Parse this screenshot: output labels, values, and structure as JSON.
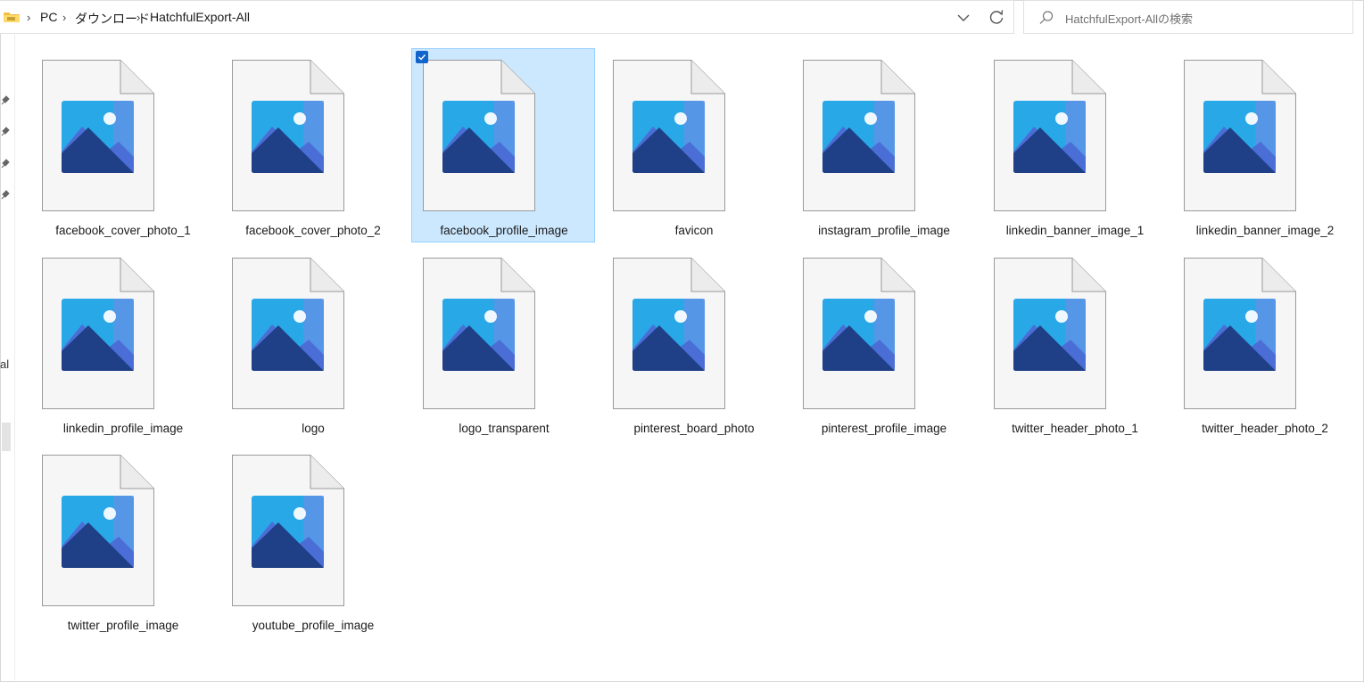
{
  "breadcrumb": {
    "items": [
      "PC",
      "ダウンロード",
      "HatchfulExport-All"
    ]
  },
  "search": {
    "placeholder": "HatchfulExport-Allの検索"
  },
  "nav_fragment": "al",
  "files": [
    {
      "name": "facebook_cover_photo_1",
      "selected": false
    },
    {
      "name": "facebook_cover_photo_2",
      "selected": false
    },
    {
      "name": "facebook_profile_image",
      "selected": true
    },
    {
      "name": "favicon",
      "selected": false
    },
    {
      "name": "instagram_profile_image",
      "selected": false
    },
    {
      "name": "linkedin_banner_image_1",
      "selected": false
    },
    {
      "name": "linkedin_banner_image_2",
      "selected": false
    },
    {
      "name": "linkedin_profile_image",
      "selected": false
    },
    {
      "name": "logo",
      "selected": false
    },
    {
      "name": "logo_transparent",
      "selected": false
    },
    {
      "name": "pinterest_board_photo",
      "selected": false
    },
    {
      "name": "pinterest_profile_image",
      "selected": false
    },
    {
      "name": "twitter_header_photo_1",
      "selected": false
    },
    {
      "name": "twitter_header_photo_2",
      "selected": false
    },
    {
      "name": "twitter_profile_image",
      "selected": false
    },
    {
      "name": "youtube_profile_image",
      "selected": false
    }
  ],
  "colors": {
    "selection_bg": "#cce8ff",
    "selection_border": "#99d1ff",
    "checkbox": "#1164c9",
    "sky": "#29a8e8",
    "mountain_dark": "#1f3f86",
    "mountain_light": "#4b6ed6"
  }
}
